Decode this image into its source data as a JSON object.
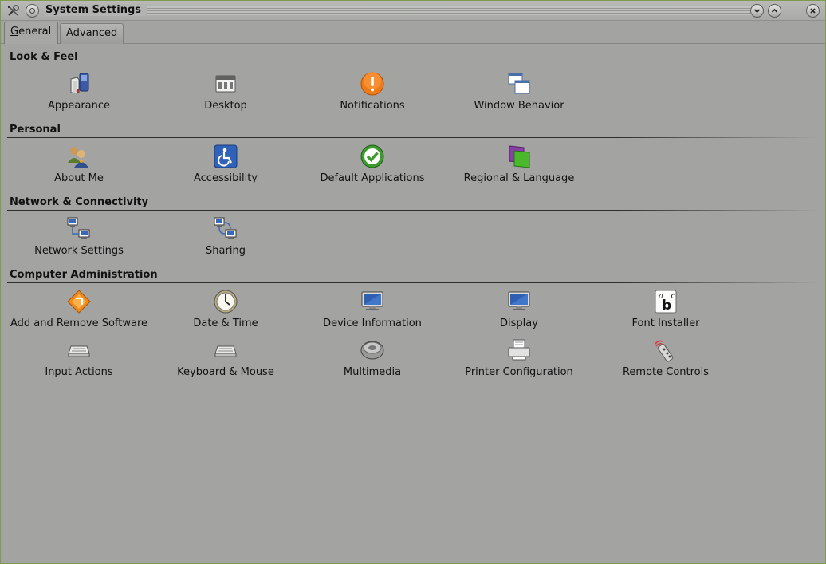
{
  "window": {
    "title": "System Settings"
  },
  "tabs": [
    {
      "label_u": "G",
      "label_rest": "eneral"
    },
    {
      "label_u": "A",
      "label_rest": "dvanced"
    }
  ],
  "sections": {
    "look": {
      "title": "Look & Feel",
      "items": [
        "Appearance",
        "Desktop",
        "Notifications",
        "Window Behavior"
      ]
    },
    "personal": {
      "title": "Personal",
      "items": [
        "About Me",
        "Accessibility",
        "Default Applications",
        "Regional & Language"
      ]
    },
    "network": {
      "title": "Network & Connectivity",
      "items": [
        "Network Settings",
        "Sharing"
      ]
    },
    "admin": {
      "title": "Computer Administration",
      "items": [
        "Add and Remove Software",
        "Date & Time",
        "Device Information",
        "Display",
        "Font Installer",
        "Input Actions",
        "Keyboard & Mouse",
        "Multimedia",
        "Printer Configuration",
        "Remote Controls"
      ]
    }
  },
  "font_installer_glyphs": {
    "a": "a",
    "b": "b",
    "c": "c"
  },
  "colors": {
    "window_bg": "#a3a4a1",
    "border_accent": "#7d9a4e",
    "notify_orange": "#f07b16",
    "accept_green": "#3d9a2c"
  }
}
